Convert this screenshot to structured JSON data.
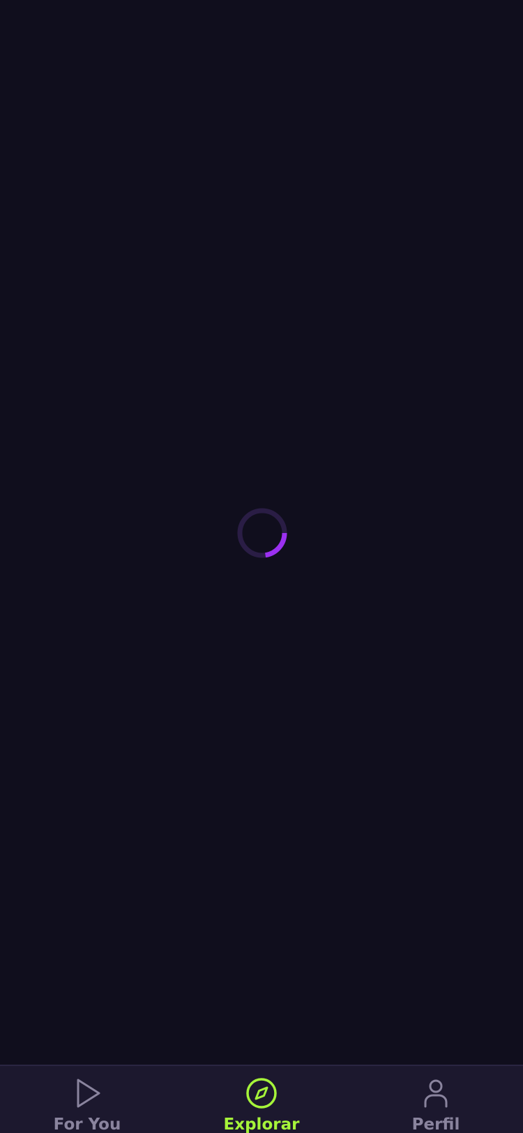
{
  "colors": {
    "background": "#100e1d",
    "tabbar_background": "#1c182e",
    "accent_active": "#a6f43a",
    "inactive": "#8a849e",
    "spinner_track": "#2a1d45",
    "spinner_arc": "#9b30f0"
  },
  "loading": {
    "icon": "loading-spinner",
    "state": "loading"
  },
  "tabbar": {
    "tabs": [
      {
        "label": "For You",
        "icon": "play-icon",
        "active": false
      },
      {
        "label": "Explorar",
        "icon": "compass-icon",
        "active": true
      },
      {
        "label": "Perfil",
        "icon": "user-icon",
        "active": false
      }
    ]
  }
}
